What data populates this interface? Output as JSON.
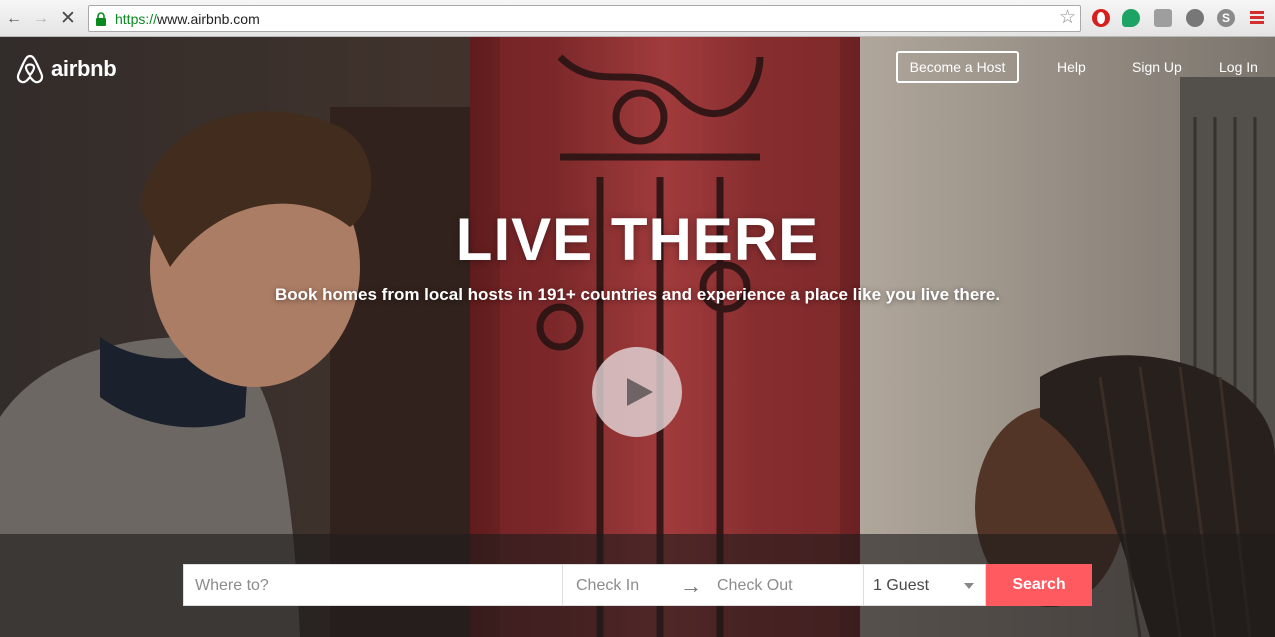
{
  "browser": {
    "url_scheme": "https://",
    "url_rest": "www.airbnb.com",
    "back_icon": "arrow-left-icon",
    "forward_icon": "arrow-right-icon",
    "stop_icon": "close-icon"
  },
  "header": {
    "brand": "airbnb",
    "become_host": "Become a Host",
    "help": "Help",
    "sign_up": "Sign Up",
    "log_in": "Log In"
  },
  "hero": {
    "headline": "LIVE THERE",
    "tagline": "Book homes from local hosts in 191+ countries and experience a place like you live there."
  },
  "search": {
    "where_placeholder": "Where to?",
    "check_in": "Check In",
    "check_out": "Check Out",
    "arrow": "→",
    "guests": "1 Guest",
    "button": "Search"
  },
  "colors": {
    "brand": "#ff5a5f",
    "url_secure": "#0a8a1e"
  }
}
